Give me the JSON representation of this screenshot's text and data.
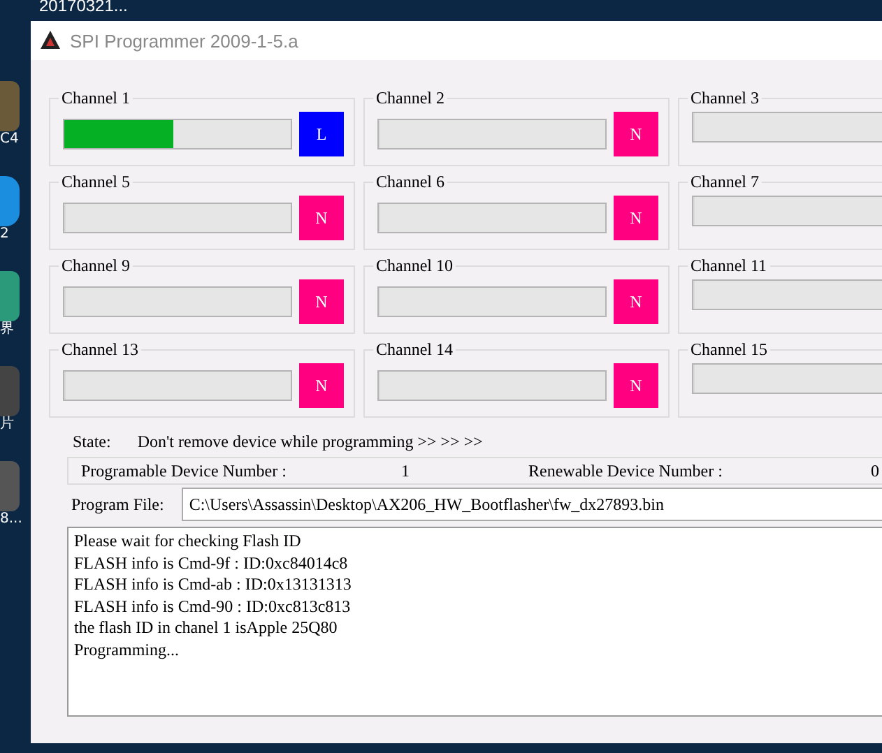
{
  "desktop": {
    "labels": [
      "20170321...",
      "C4",
      "2",
      "界",
      "片",
      "8..."
    ]
  },
  "window": {
    "title": "SPI Programmer 2009-1-5.a"
  },
  "channels": [
    {
      "label": "Channel 1",
      "level": 0.48,
      "status": "L",
      "color": "#0000ff"
    },
    {
      "label": "Channel 2",
      "level": 0,
      "status": "N",
      "color": "#ff0080"
    },
    {
      "label": "Channel  3",
      "level": 0
    },
    {
      "label": "Channel 5",
      "level": 0,
      "status": "N",
      "color": "#ff0080"
    },
    {
      "label": "Channel  6",
      "level": 0,
      "status": "N",
      "color": "#ff0080"
    },
    {
      "label": "Channel  7",
      "level": 0
    },
    {
      "label": "Channel  9",
      "level": 0,
      "status": "N",
      "color": "#ff0080"
    },
    {
      "label": "Channel 10",
      "level": 0,
      "status": "N",
      "color": "#ff0080"
    },
    {
      "label": "Channel 11",
      "level": 0
    },
    {
      "label": "Channel 13",
      "level": 0,
      "status": "N",
      "color": "#ff0080"
    },
    {
      "label": "Channel 14",
      "level": 0,
      "status": "N",
      "color": "#ff0080"
    },
    {
      "label": "Channel 15",
      "level": 0
    }
  ],
  "state": {
    "label": "State:",
    "value": "Don't remove device while programming >> >> >>"
  },
  "counts": {
    "programable_label": "Programable Device Number :",
    "programable_value": "1",
    "renewable_label": "Renewable Device Number :",
    "renewable_value": "0"
  },
  "program_file": {
    "label": "Program File:",
    "value": "C:\\Users\\Assassin\\Desktop\\AX206_HW_Bootflasher\\fw_dx27893.bin"
  },
  "log": [
    "Please wait for checking Flash ID",
    "FLASH info is Cmd-9f : ID:0xc84014c8",
    "FLASH info is Cmd-ab : ID:0x13131313",
    "FLASH info is Cmd-90 : ID:0xc813c813",
    "the flash ID in chanel  1 isApple 25Q80",
    "Programming..."
  ]
}
